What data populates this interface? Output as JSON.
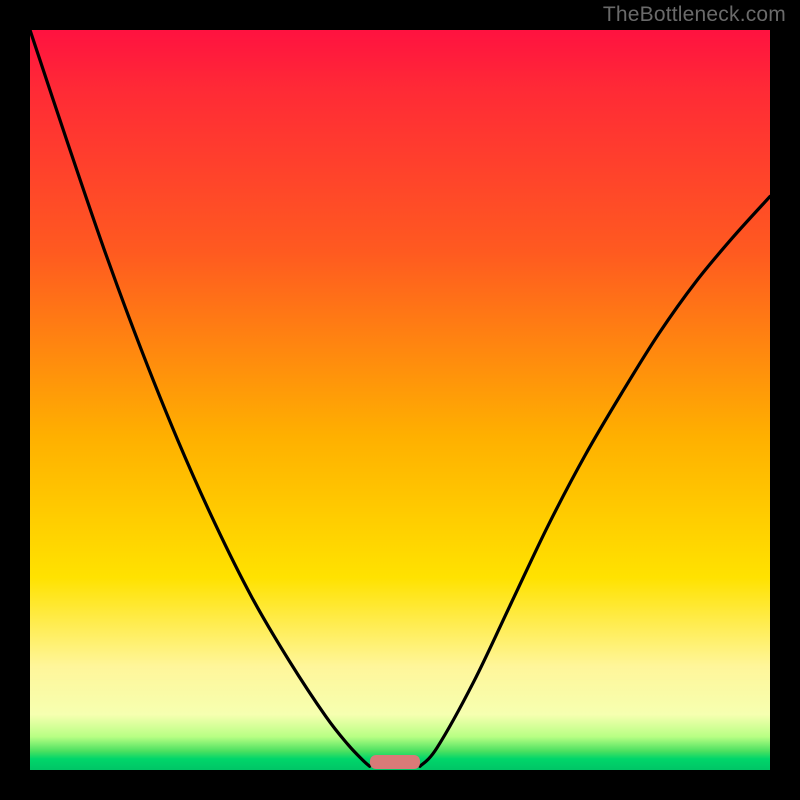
{
  "watermark": "TheBottleneck.com",
  "chart_data": {
    "type": "line",
    "title": "",
    "xlabel": "",
    "ylabel": "",
    "xlim": [
      0,
      1
    ],
    "ylim": [
      0,
      1
    ],
    "grid": false,
    "legend": false,
    "series": [
      {
        "name": "left-curve",
        "x": [
          0.0,
          0.05,
          0.1,
          0.15,
          0.2,
          0.25,
          0.3,
          0.35,
          0.4,
          0.43,
          0.45,
          0.459
        ],
        "y": [
          1.0,
          0.85,
          0.704,
          0.569,
          0.445,
          0.333,
          0.233,
          0.148,
          0.072,
          0.034,
          0.013,
          0.005
        ]
      },
      {
        "name": "right-curve",
        "x": [
          0.527,
          0.55,
          0.6,
          0.65,
          0.7,
          0.75,
          0.8,
          0.85,
          0.9,
          0.95,
          1.0
        ],
        "y": [
          0.005,
          0.03,
          0.12,
          0.225,
          0.33,
          0.425,
          0.51,
          0.59,
          0.66,
          0.72,
          0.775
        ]
      }
    ],
    "marker": {
      "name": "bottleneck-stub",
      "color": "#d97a78",
      "x_start": 0.459,
      "x_end": 0.527,
      "y": 0.0
    },
    "background_gradient": {
      "direction": "vertical",
      "stops": [
        {
          "pos": 0.0,
          "color": "#ff1240"
        },
        {
          "pos": 0.08,
          "color": "#ff2a36"
        },
        {
          "pos": 0.3,
          "color": "#ff5a20"
        },
        {
          "pos": 0.55,
          "color": "#ffb000"
        },
        {
          "pos": 0.74,
          "color": "#ffe200"
        },
        {
          "pos": 0.86,
          "color": "#fff69a"
        },
        {
          "pos": 0.93,
          "color": "#f6ffb0"
        },
        {
          "pos": 0.955,
          "color": "#b8ff84"
        },
        {
          "pos": 0.975,
          "color": "#48e060"
        },
        {
          "pos": 0.985,
          "color": "#00d66a"
        },
        {
          "pos": 1.0,
          "color": "#00c566"
        }
      ]
    }
  }
}
